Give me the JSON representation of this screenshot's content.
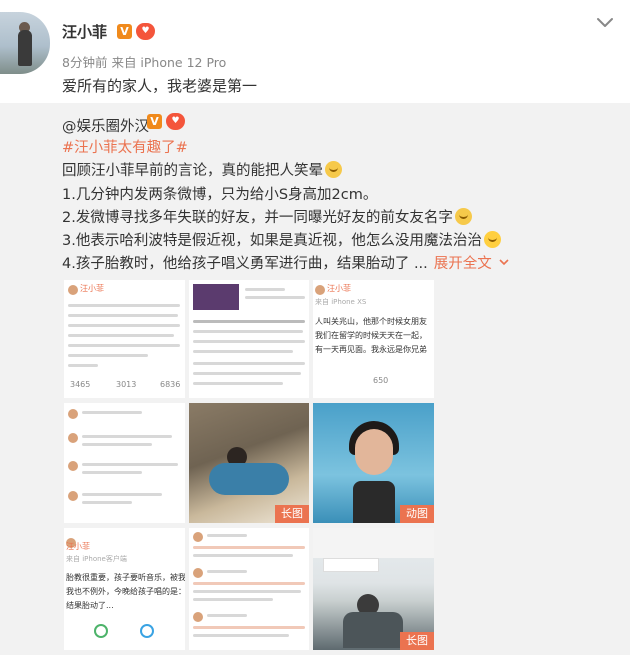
{
  "post": {
    "username": "汪小菲",
    "v_badge": "V",
    "fan_badge": "铁粉",
    "time": "8分钟前",
    "source": "来自 iPhone 12 Pro",
    "text": "爱所有的家人，我老婆是第一"
  },
  "repost": {
    "author": "@娱乐圈外汉",
    "hashtag": "#汪小菲太有趣了#",
    "line_intro": "回顾汪小菲早前的言论，真的能把人笑晕",
    "line_1": "1.几分钟内发两条微博，只为给小S身高加2cm。",
    "line_2": "2.发微博寻找多年失联的好友，并一同曝光好友的前女友名字",
    "line_3": "3.他表示哈利波特是假近视，如果是真近视，他怎么没用魔法治治",
    "line_4": "4.孩子胎教时，他给孩子唱义勇军进行曲，结果胎动了 ...",
    "expand_label": "展开全文",
    "images": [
      {
        "kind": "screenshot",
        "tag": ""
      },
      {
        "kind": "screenshot",
        "tag": ""
      },
      {
        "kind": "screenshot",
        "tag": ""
      },
      {
        "kind": "screenshot",
        "tag": ""
      },
      {
        "kind": "photo",
        "tag": "长图"
      },
      {
        "kind": "photo",
        "tag": "动图"
      },
      {
        "kind": "screenshot",
        "tag": ""
      },
      {
        "kind": "screenshot",
        "tag": ""
      },
      {
        "kind": "photo",
        "tag": "长图"
      }
    ],
    "image_text": {
      "img1_name": "汪小菲",
      "img1_counts": [
        "3465",
        "3013",
        "6836"
      ],
      "img3_name": "汪小菲",
      "img3_source": "来自 iPhone XS",
      "img3_lines": [
        "人叫关兆山，他那个时候女朋友",
        "我们在留学的时候天天在一起，",
        "有一天再见面。我永远是你兄弟"
      ],
      "img3_count": "650",
      "img7_name": "汪小菲",
      "img7_source": "来自 iPhone客户端",
      "img7_lines": [
        "胎教很重要，孩子要听音乐，被我",
        "我也不例外，今晚给孩子唱的是：",
        "结果胎动了..."
      ]
    }
  },
  "colors": {
    "accent": "#eb7350",
    "vip_orange": "#f08a1c",
    "fan_red": "#f4553b",
    "repost_bg": "#f2f2f2"
  },
  "icons": {
    "more_menu": "chevron-down-icon",
    "expand": "chevron-down-icon"
  }
}
